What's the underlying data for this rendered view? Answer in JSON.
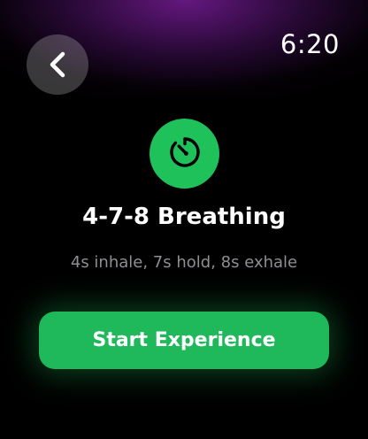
{
  "status_bar": {
    "time": "6:20"
  },
  "navigation": {
    "back_icon": "chevron-left-icon"
  },
  "exercise": {
    "icon": "timer-icon",
    "icon_color": "#1fc25a",
    "title": "4-7-8 Breathing",
    "description": "4s inhale, 7s hold, 8s exhale"
  },
  "actions": {
    "start_label": "Start Experience",
    "start_color": "#1fb85a"
  },
  "colors": {
    "background": "#000000",
    "header_glow": "#761c96",
    "subtitle_text": "#8e8e93"
  }
}
